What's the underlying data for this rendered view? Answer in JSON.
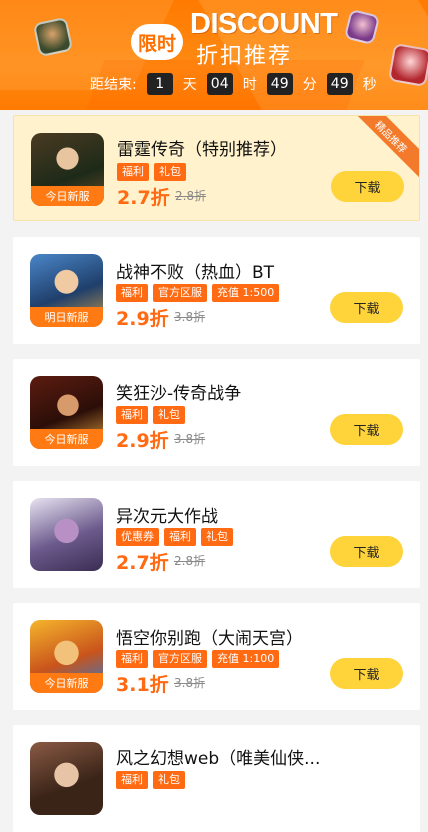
{
  "banner": {
    "badge": "限时",
    "title": "DISCOUNT",
    "subtitle": "折扣推荐",
    "countdown": {
      "label": "距结束:",
      "days": "1",
      "days_unit": "天",
      "hours": "04",
      "hours_unit": "时",
      "minutes": "49",
      "minutes_unit": "分",
      "seconds": "49",
      "seconds_unit": "秒"
    }
  },
  "download_label": "下载",
  "featured_ribbon": "精品推荐",
  "games": [
    {
      "name": "雷霆传奇（特别推荐）",
      "server_tag": "今日新服",
      "tags": [
        "福利",
        "礼包"
      ],
      "discount": "2.7折",
      "original": "2.8折"
    },
    {
      "name": "战神不败（热血）BT",
      "server_tag": "明日新服",
      "tags": [
        "福利",
        "官方区服",
        "充值 1:500"
      ],
      "discount": "2.9折",
      "original": "3.8折"
    },
    {
      "name": "笑狂沙-传奇战争",
      "server_tag": "今日新服",
      "tags": [
        "福利",
        "礼包"
      ],
      "discount": "2.9折",
      "original": "3.8折"
    },
    {
      "name": "异次元大作战",
      "server_tag": "",
      "tags": [
        "优惠券",
        "福利",
        "礼包"
      ],
      "discount": "2.7折",
      "original": "2.8折"
    },
    {
      "name": "悟空你别跑（大闹天宫）",
      "server_tag": "今日新服",
      "tags": [
        "福利",
        "官方区服",
        "充值 1:100"
      ],
      "discount": "3.1折",
      "original": "3.8折"
    },
    {
      "name": "风之幻想web（唯美仙侠...",
      "server_tag": "",
      "tags": [
        "福利",
        "礼包"
      ],
      "discount": "",
      "original": ""
    }
  ],
  "colors": {
    "accent": "#ff7a00",
    "tag": "#ff6a12",
    "download": "#ffd33a",
    "featured_bg": "#fff2cc"
  }
}
